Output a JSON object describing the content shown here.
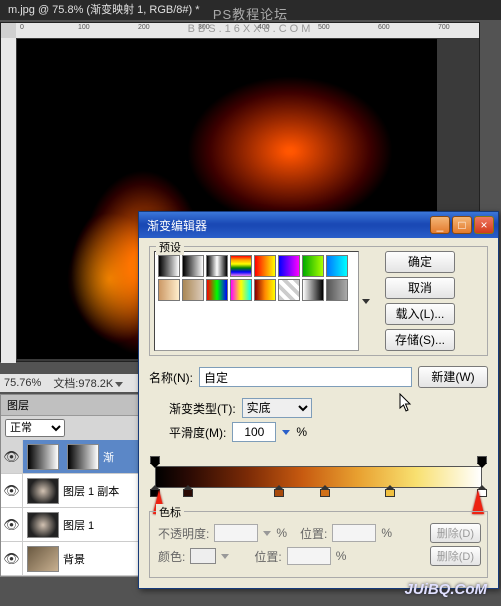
{
  "watermark": {
    "line1": "PS教程论坛",
    "line2": "BBS.16XX8.COM",
    "br": "JUiBQ.CoM"
  },
  "doc": {
    "tab": "m.jpg @ 75.8% (渐变映射 1, RGB/8#) *",
    "zoom": "75.76%",
    "docinfo": "文档:978.2K"
  },
  "ruler": {
    "t0": "0",
    "t1": "100",
    "t2": "200",
    "t3": "300",
    "t4": "400",
    "t5": "500",
    "t6": "600",
    "t7": "700"
  },
  "layers": {
    "panel_title": "图层",
    "blend_mode": "正常",
    "items": [
      {
        "name": "渐",
        "thumb": "grad",
        "sel": true
      },
      {
        "name": "图层 1 副本",
        "thumb": "fire",
        "sel": false
      },
      {
        "name": "图层 1",
        "thumb": "fire",
        "sel": false
      },
      {
        "name": "背景",
        "thumb": "photo",
        "sel": false
      }
    ]
  },
  "dialog": {
    "title": "渐变编辑器",
    "presets_label": "预设",
    "btn_ok": "确定",
    "btn_cancel": "取消",
    "btn_load": "载入(L)...",
    "btn_save": "存储(S)...",
    "name_label": "名称(N):",
    "name_value": "自定",
    "btn_new": "新建(W)",
    "type_label": "渐变类型(T):",
    "type_value": "实底",
    "smooth_label": "平滑度(M):",
    "smooth_value": "100",
    "smooth_unit": "%",
    "stops_label": "色标",
    "opacity_label": "不透明度:",
    "pct": "%",
    "pos_label": "位置:",
    "color_label": "颜色:",
    "delete_label": "删除(D)"
  },
  "gradient": {
    "opacity_stops": [
      0,
      100
    ],
    "color_stops": [
      {
        "pos": 0,
        "color": "#000000"
      },
      {
        "pos": 10,
        "color": "#2a0a04"
      },
      {
        "pos": 38,
        "color": "#a84a0c"
      },
      {
        "pos": 52,
        "color": "#d07018"
      },
      {
        "pos": 72,
        "color": "#f0c040"
      },
      {
        "pos": 100,
        "color": "#ffffff"
      }
    ]
  },
  "presets": [
    "linear-gradient(to right,#000,#fff)",
    "linear-gradient(to right,#000,transparent)",
    "linear-gradient(to right,#000,#fff,#000)",
    "linear-gradient(to bottom,red,orange,yellow,green,blue,violet)",
    "linear-gradient(to right,#f00,#ff0)",
    "linear-gradient(to right,#00f,#f0f)",
    "linear-gradient(to right,#0a0,#af0)",
    "linear-gradient(to right,#07f,#0ff)",
    "linear-gradient(to right,#c96,#fec)",
    "linear-gradient(to right,#a85,#dcb)",
    "linear-gradient(to right,#f00,#0f0,#00f)",
    "linear-gradient(to right,#f0f,#ff0,#0ff)",
    "linear-gradient(to right,#800,#f80,#ff0)",
    "repeating-linear-gradient(45deg,#ccc 0 4px,#fff 4px 8px)",
    "linear-gradient(to right,#fff,#000)",
    "linear-gradient(to right,#555,#aaa)"
  ]
}
